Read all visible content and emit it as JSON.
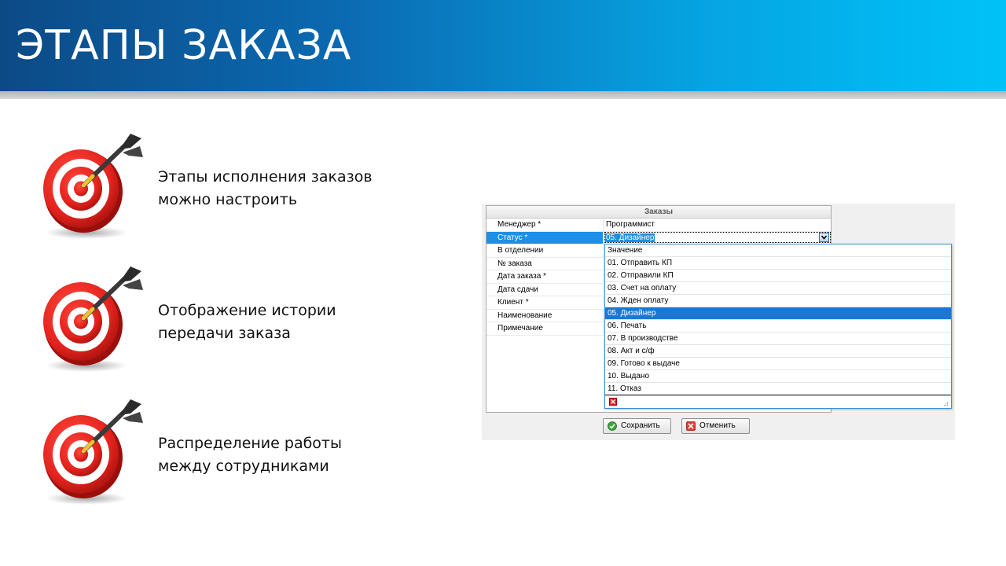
{
  "slide": {
    "title": "ЭТАПЫ ЗАКАЗА"
  },
  "bullets": [
    {
      "icon": "target-dart-icon",
      "lines": [
        "Этапы исполнения заказов",
        "можно настроить"
      ]
    },
    {
      "icon": "target-dart-icon",
      "lines": [
        "Отображение истории",
        "передачи заказа"
      ]
    },
    {
      "icon": "target-dart-icon",
      "lines": [
        "Распределение работы",
        "между сотрудниками"
      ]
    }
  ],
  "form": {
    "title": "Заказы",
    "fields": [
      {
        "label": "Менеджер *",
        "value": "Программист"
      },
      {
        "label": "Статус *",
        "value": "05. Дизайнер"
      },
      {
        "label": "В отделении",
        "value": ""
      },
      {
        "label": "№ заказа",
        "value": ""
      },
      {
        "label": "Дата заказа *",
        "value": ""
      },
      {
        "label": "Дата сдачи",
        "value": ""
      },
      {
        "label": "Клиент *",
        "value": ""
      },
      {
        "label": "Наименование",
        "value": ""
      },
      {
        "label": "Примечание",
        "value": ""
      }
    ],
    "dropdown": {
      "header": "Значение",
      "options": [
        "01. Отправить КП",
        "02. Отправили КП",
        "03. Счет на оплату",
        "04. Жден оплату",
        "05. Дизайнер",
        "06. Печать",
        "07. В производстве",
        "08. Акт и с/ф",
        "09. Готово к выдаче",
        "10. Выдано",
        "11. Отказ"
      ],
      "selected": "05. Дизайнер"
    },
    "buttons": {
      "save": "Сохранить",
      "cancel": "Отменить"
    }
  },
  "colors": {
    "header_start": "#0c4a86",
    "header_end": "#00c2f7",
    "selection": "#1e8fe6",
    "target_red": "#e3231d"
  }
}
